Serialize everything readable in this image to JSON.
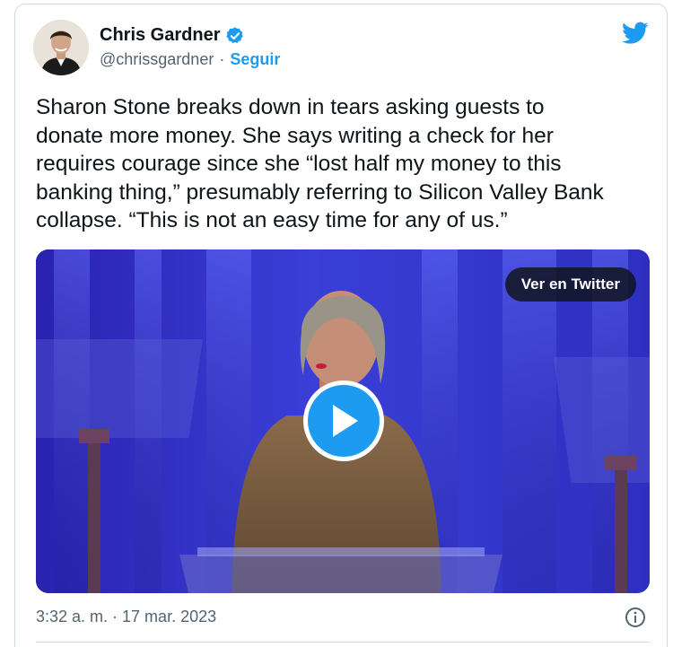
{
  "author": {
    "name": "Chris Gardner",
    "handle": "@chrissgardner",
    "separator": "·",
    "follow_label": "Seguir"
  },
  "tweet": {
    "text": "Sharon Stone breaks down in tears asking guests to\ndonate more money. She says writing a check for her\nrequires courage since she “lost half my money to this\nbanking thing,” presumably referring to Silicon Valley Bank\ncollapse. “This is not an easy time for any of us.”"
  },
  "media": {
    "view_on_twitter_label": "Ver en Twitter",
    "icon": "play-icon"
  },
  "footer": {
    "timestamp": "3:32 a. m. · 17 mar. 2023",
    "icon": "info-icon"
  },
  "colors": {
    "accent": "#1d9bf0",
    "text": "#0f1419",
    "secondary": "#536471",
    "border": "#cfd9de"
  }
}
